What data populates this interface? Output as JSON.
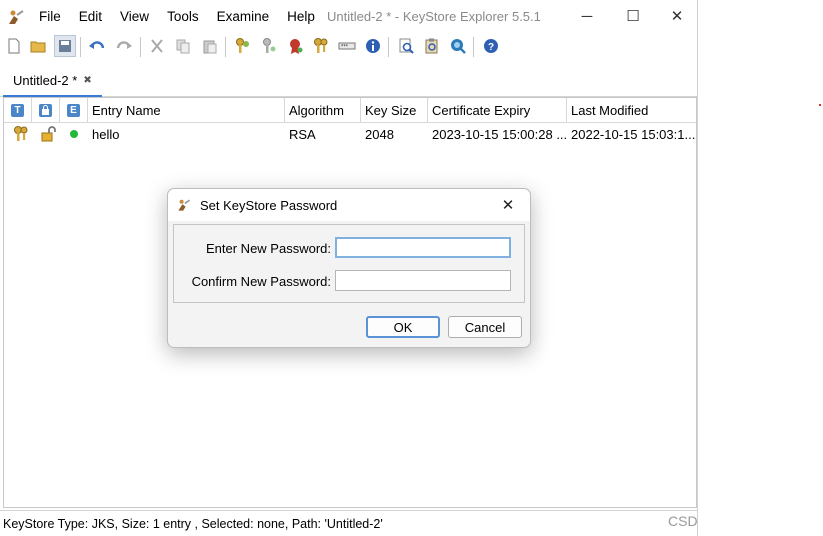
{
  "window": {
    "title": "Untitled-2 * - KeyStore Explorer 5.5.1",
    "minimize_glyph": "─",
    "maximize_glyph": "☐",
    "close_glyph": "✕"
  },
  "menu": [
    "File",
    "Edit",
    "View",
    "Tools",
    "Examine",
    "Help"
  ],
  "toolbar": {
    "icons": [
      "new-icon",
      "open-icon",
      "save-icon",
      "undo-icon",
      "redo-icon",
      "cut-icon",
      "copy-icon",
      "paste-icon",
      "generate-keypair-icon",
      "generate-secret-key-icon",
      "import-trusted-cert-icon",
      "import-keypair-icon",
      "set-password-icon",
      "properties-icon",
      "examine-file-icon",
      "examine-clipboard-icon",
      "examine-ssl-icon",
      "help-icon"
    ]
  },
  "tab": {
    "label": "Untitled-2 *",
    "close_glyph": "✖"
  },
  "table": {
    "header_badges": {
      "type": "T",
      "lock": "🔒",
      "expiry": "E"
    },
    "columns": [
      "Entry Name",
      "Algorithm",
      "Key Size",
      "Certificate Expiry",
      "Last Modified"
    ],
    "rows": [
      {
        "entry_name": "hello",
        "algorithm": "RSA",
        "key_size": "2048",
        "certificate_expiry": "2023-10-15 15:00:28 ...",
        "last_modified": "2022-10-15 15:03:1..."
      }
    ]
  },
  "statusbar": {
    "text": "KeyStore Type: JKS, Size: 1 entry , Selected: none, Path: 'Untitled-2'"
  },
  "watermark": "CSD",
  "dialog": {
    "title": "Set KeyStore Password",
    "close_glyph": "✕",
    "new_password_label": "Enter New Password:",
    "new_password_value": "",
    "confirm_password_label": "Confirm New Password:",
    "confirm_password_value": "",
    "ok_label": "OK",
    "cancel_label": "Cancel"
  },
  "colors": {
    "accent": "#3a7bd5",
    "status_ok": "#22b83a",
    "dialog_bg": "#f3f3f3"
  }
}
